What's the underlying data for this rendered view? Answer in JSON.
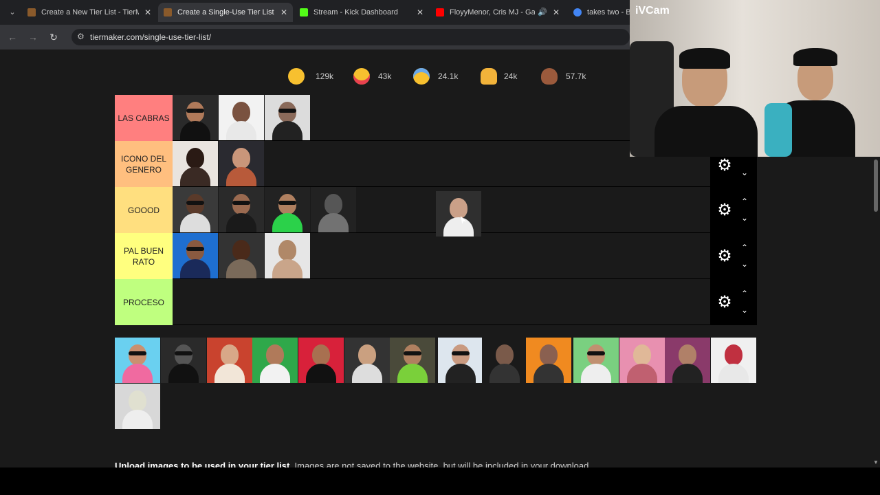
{
  "browser": {
    "tabs": [
      {
        "title": "Create a New Tier List - TierMaker",
        "color": "#b5651d",
        "active": false
      },
      {
        "title": "Create a Single-Use Tier List (Pr",
        "color": "#b5651d",
        "active": true
      },
      {
        "title": "Stream - Kick Dashboard",
        "color": "#53fc18",
        "active": false
      },
      {
        "title": "FloyyMenor, Cris MJ - Gata",
        "color": "#ff0000",
        "active": false
      },
      {
        "title": "takes two - Bu",
        "color": "#4285f4",
        "active": false
      }
    ],
    "url": "tiermaker.com/single-use-tier-list/"
  },
  "reactions": [
    {
      "icon": "grinning-face-icon",
      "count": "129k"
    },
    {
      "icon": "heart-eyes-face-icon",
      "count": "43k"
    },
    {
      "icon": "laughing-crying-face-icon",
      "count": "24.1k"
    },
    {
      "icon": "raising-hands-icon",
      "count": "24k"
    },
    {
      "icon": "poop-icon",
      "count": "57.7k"
    }
  ],
  "tiers": [
    {
      "label": "LAS CABRAS",
      "color": "#ff7f7f",
      "items": 3
    },
    {
      "label": "ICONO DEL GENERO",
      "color": "#ffbf7f",
      "items": 2
    },
    {
      "label": "GOOOD",
      "color": "#ffdf7f",
      "items": 4
    },
    {
      "label": "PAL BUEN RATO",
      "color": "#ffff7f",
      "items": 3
    },
    {
      "label": "PROCESO",
      "color": "#bfff7f",
      "items": 0
    }
  ],
  "pool_count": 15,
  "upload": {
    "bold": "Upload images to be used in your tier list",
    "rest": ". Images are not saved to the website, but will be included in your download."
  },
  "webcam": {
    "overlay_text": "iVCam"
  }
}
